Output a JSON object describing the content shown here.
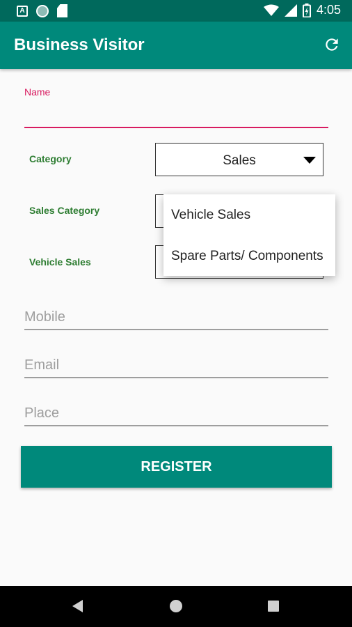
{
  "status_bar": {
    "time": "4:05",
    "left_icons": [
      "a-badge-icon",
      "circle-icon",
      "sd-card-icon"
    ],
    "right_icons": [
      "wifi-icon",
      "signal-icon",
      "battery-icon"
    ],
    "a_badge": "A"
  },
  "app_bar": {
    "title": "Business Visitor",
    "action_icon": "refresh-icon"
  },
  "form": {
    "name_label": "Name",
    "name_value": "",
    "category": {
      "label": "Category",
      "value": "Sales"
    },
    "sales_category": {
      "label": "Sales Category",
      "value": ""
    },
    "vehicle_sales": {
      "label": "Vehicle Sales",
      "value": ""
    },
    "mobile_placeholder": "Mobile",
    "email_placeholder": "Email",
    "place_placeholder": "Place",
    "register_label": "REGISTER"
  },
  "dropdown": {
    "items": [
      "Vehicle Sales",
      "Spare Parts/ Components"
    ]
  },
  "colors": {
    "primary": "#00897b",
    "primary_dark": "#00695c",
    "accent": "#d81b60",
    "label_green": "#2e7d32"
  },
  "nav_bar": {
    "icons": [
      "back-icon",
      "home-icon",
      "recents-icon"
    ]
  }
}
